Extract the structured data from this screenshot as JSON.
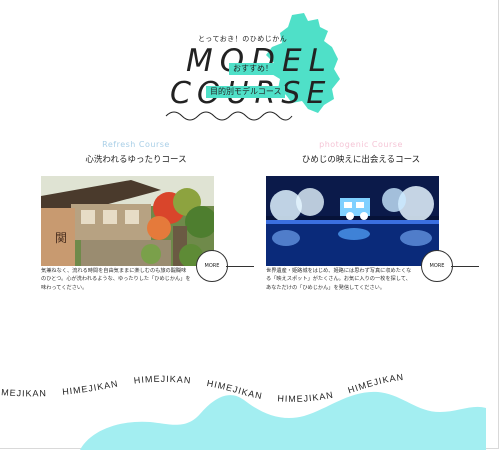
{
  "hero": {
    "tagline": "とっておき！のひめじかん",
    "title_line1": "MODEL",
    "title_line2": "COURSE",
    "badge_recommended": "おすすめ！",
    "badge_purpose": "目的別モデルコース"
  },
  "courses": [
    {
      "title_en": "Refresh Course",
      "title_ja": "心洗われるゆったりコース",
      "more_label": "MORE",
      "description": "気兼ねなく、流れる時間を自由気ままに楽しむのも旅の醍醐味のひとつ。心が洗われるような、ゆったりした「ひめじかん」を味わってください。"
    },
    {
      "title_en": "photogenic Course",
      "title_ja": "ひめじの映えに出会えるコース",
      "more_label": "MORE",
      "description": "世界遺産・姫路城をはじめ、姫路には思わず写真に収めたくなる「映えスポット」がたくさん。お気に入りの一枚を探して、あなただけの「ひめじかん」を発信してください。"
    }
  ],
  "footer": {
    "marquee_text": "HIMEJIKAN"
  },
  "colors": {
    "accent_mint": "#4fe0c8",
    "refresh_blue": "#a9cfe7",
    "photogenic_pink": "#f5c5d6",
    "footer_wave": "#a3eef1"
  }
}
